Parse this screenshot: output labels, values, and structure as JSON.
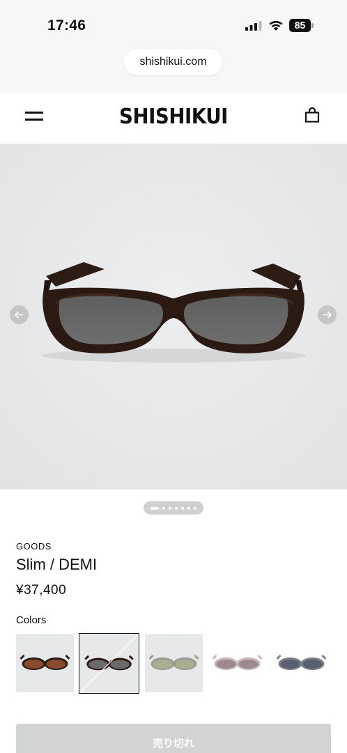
{
  "status_bar": {
    "time": "17:46",
    "battery": "85"
  },
  "browser": {
    "url": "shishikui.com"
  },
  "header": {
    "brand": "SHISHIKUI"
  },
  "product": {
    "category": "GOODS",
    "name": "Slim / DEMI",
    "price": "¥37,400",
    "image_count": 7,
    "active_image_index": 0
  },
  "colors": {
    "label": "Colors",
    "selected_index": 1,
    "swatches": [
      {
        "name": "brown-lens-black-frame",
        "frame": "#2a1d17",
        "lens": "#8a4a2c"
      },
      {
        "name": "demi-gray-lens",
        "frame": "#2b1a12",
        "lens": "#6b6b6b"
      },
      {
        "name": "green-lens-clear",
        "frame": "#9a9a92",
        "lens": "#a9ae8f"
      },
      {
        "name": "pink-lens-clear",
        "frame": "#c9b7b3",
        "lens": "#9c8a90"
      },
      {
        "name": "navy-lens-gray",
        "frame": "#7a8086",
        "lens": "#5a6072"
      }
    ]
  },
  "cta": {
    "label": "売り切れ"
  }
}
